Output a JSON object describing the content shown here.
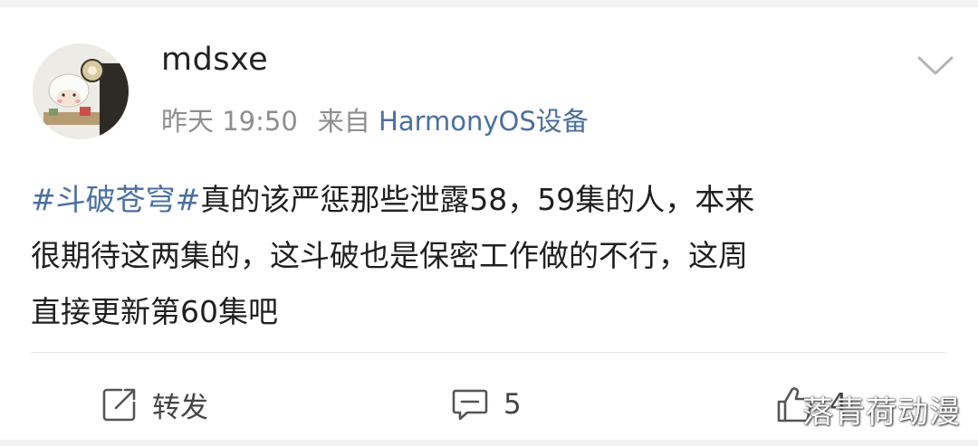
{
  "post": {
    "username": "mdsxe",
    "time": "昨天 19:50",
    "source_prefix": "来自",
    "source": "HarmonyOS设备",
    "topic": "#斗破苍穹#",
    "text_line1_rest": "真的该严惩那些泄露58，59集的人，本来",
    "text_line2": "很期待这两集的，这斗破也是保密工作做的不行，这周",
    "text_line3": "直接更新第60集吧"
  },
  "actions": {
    "repost_label": "转发",
    "comment_count": "5",
    "like_count": "4"
  },
  "watermark": "落青荷动漫",
  "colors": {
    "link_blue": "#4a6fa1",
    "text": "#1f1f1f",
    "meta_gray": "#8e8e8e"
  },
  "icons": {
    "expand": "chevron-down-icon",
    "repost": "repost-icon",
    "comment": "comment-icon",
    "like": "thumbs-up-icon"
  }
}
